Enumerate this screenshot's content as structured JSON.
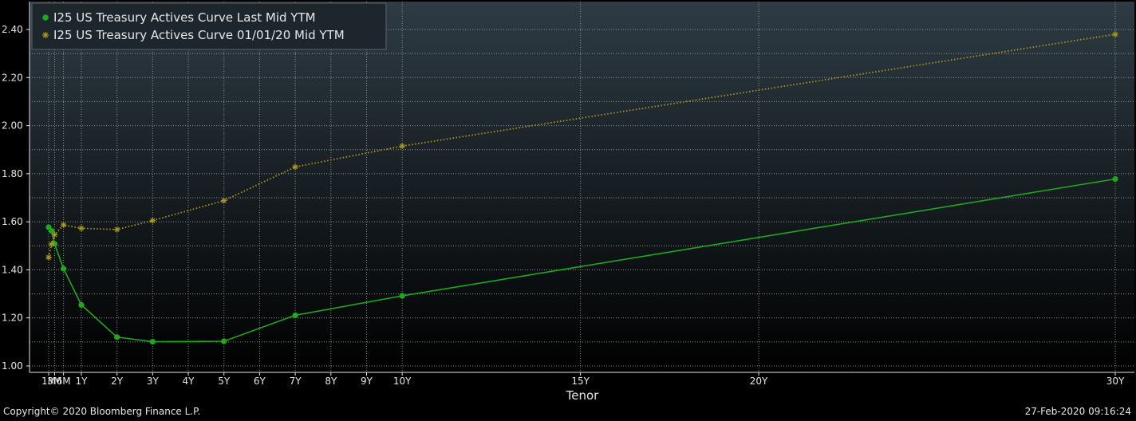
{
  "chart_data": {
    "type": "line",
    "title": "",
    "xlabel": "Tenor",
    "ylabel": "",
    "ylim": [
      0.98,
      2.45
    ],
    "xlim": [
      0.083,
      30.2
    ],
    "yticks": [
      1.0,
      1.2,
      1.4,
      1.6,
      1.8,
      2.0,
      2.2,
      2.4
    ],
    "ytick_labels": [
      "1.00",
      "1.20",
      "1.40",
      "1.60",
      "1.80",
      "2.00",
      "2.20",
      "2.40"
    ],
    "xticks": [
      {
        "t": 0.0833,
        "label": "1M"
      },
      {
        "t": 0.25,
        "label": "3M"
      },
      {
        "t": 0.5,
        "label": "6M"
      },
      {
        "t": 1,
        "label": "1Y"
      },
      {
        "t": 2,
        "label": "2Y"
      },
      {
        "t": 3,
        "label": "3Y"
      },
      {
        "t": 4,
        "label": "4Y"
      },
      {
        "t": 5,
        "label": "5Y"
      },
      {
        "t": 6,
        "label": "6Y"
      },
      {
        "t": 7,
        "label": "7Y"
      },
      {
        "t": 8,
        "label": "8Y"
      },
      {
        "t": 9,
        "label": "9Y"
      },
      {
        "t": 10,
        "label": "10Y"
      },
      {
        "t": 15,
        "label": "15Y"
      },
      {
        "t": 20,
        "label": "20Y"
      },
      {
        "t": 30,
        "label": "30Y"
      }
    ],
    "grid": true,
    "legend_position": "top-left",
    "series": [
      {
        "name": "I25 US Treasury Actives Curve Last Mid YTM",
        "color": "#1fa71f",
        "marker": "circle",
        "line_style": "solid",
        "points": [
          {
            "t": 0.0833,
            "v": 1.577
          },
          {
            "t": 0.1667,
            "v": 1.562
          },
          {
            "t": 0.25,
            "v": 1.508
          },
          {
            "t": 0.5,
            "v": 1.405
          },
          {
            "t": 1,
            "v": 1.254
          },
          {
            "t": 2,
            "v": 1.12
          },
          {
            "t": 3,
            "v": 1.101
          },
          {
            "t": 5,
            "v": 1.103
          },
          {
            "t": 7,
            "v": 1.211
          },
          {
            "t": 10,
            "v": 1.292
          },
          {
            "t": 30,
            "v": 1.778
          }
        ]
      },
      {
        "name": "I25 US Treasury Actives Curve 01/01/20 Mid YTM",
        "color": "#a99a1c",
        "marker": "asterisk",
        "line_style": "dotted",
        "points": [
          {
            "t": 0.0833,
            "v": 1.452
          },
          {
            "t": 0.1667,
            "v": 1.507
          },
          {
            "t": 0.25,
            "v": 1.546
          },
          {
            "t": 0.5,
            "v": 1.587
          },
          {
            "t": 1,
            "v": 1.573
          },
          {
            "t": 2,
            "v": 1.568
          },
          {
            "t": 3,
            "v": 1.605
          },
          {
            "t": 5,
            "v": 1.688
          },
          {
            "t": 7,
            "v": 1.828
          },
          {
            "t": 10,
            "v": 1.915
          },
          {
            "t": 30,
            "v": 2.38
          }
        ]
      }
    ]
  },
  "footer": {
    "copyright": "Copyright© 2020 Bloomberg Finance L.P.",
    "timestamp": "27-Feb-2020 09:16:24"
  },
  "colors": {
    "background_top": "#2e3b44",
    "background_bottom": "#000000",
    "grid": "#b8b8b8",
    "text": "#e6e6e6"
  }
}
